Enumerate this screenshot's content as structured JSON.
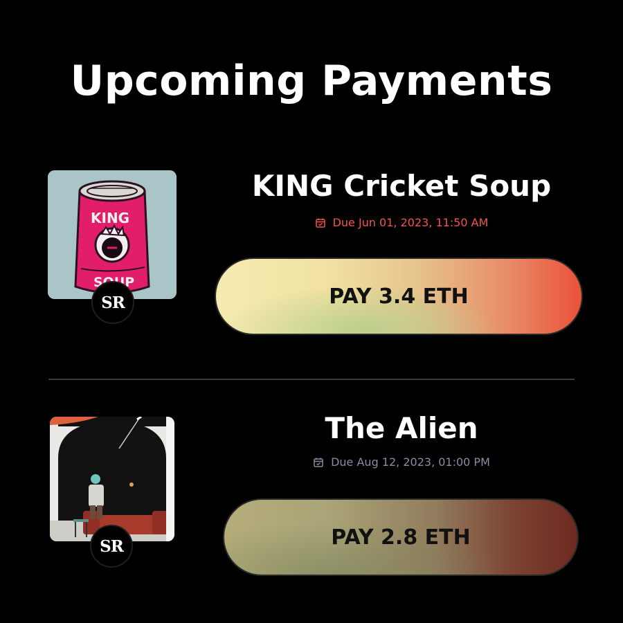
{
  "header": {
    "title": "Upcoming Payments"
  },
  "payments": [
    {
      "title": "KING Cricket Soup",
      "due": "Due Jun 01, 2023, 11:50 AM",
      "due_color": "#f2544f",
      "pay_label": "PAY 3.4 ETH",
      "badge": "SR",
      "thumbnail": "king-soup-can-artwork",
      "thumbnail_text": [
        "KING",
        "SOUP"
      ]
    },
    {
      "title": "The Alien",
      "due": "Due Aug 12, 2023, 01:00 PM",
      "due_color": "#8f8aa6",
      "pay_label": "PAY 2.8 ETH",
      "badge": "SR",
      "thumbnail": "alien-room-artwork"
    }
  ],
  "icons": {
    "due": "calendar-check-icon"
  },
  "colors": {
    "background": "#000000",
    "divider": "#3b3b3b"
  }
}
